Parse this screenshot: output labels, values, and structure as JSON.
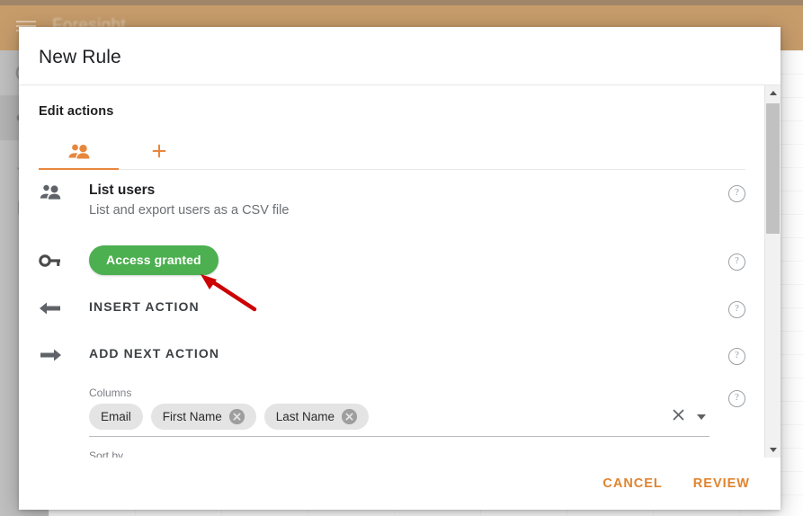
{
  "background": {
    "app_title": "Foresight",
    "menu_icon": "hamburger-icon",
    "appbar_color": "#a9681d",
    "sidebar_icons": [
      "clock-icon",
      "key-icon",
      "chart-icon",
      "building-icon"
    ]
  },
  "dialog": {
    "title": "New Rule",
    "section_heading": "Edit actions",
    "tabs": [
      {
        "icon": "people-icon",
        "name": "tab-users",
        "active": true
      },
      {
        "icon": "plus-icon",
        "name": "tab-add",
        "active": false
      }
    ],
    "accent_color": "#e8873c",
    "rows": {
      "list_users": {
        "icon": "people-icon",
        "title": "List users",
        "subtitle": "List and export users as a CSV file",
        "help": "?"
      },
      "access": {
        "icon": "key-icon",
        "badge_label": "Access granted",
        "badge_color": "#4caf50",
        "help": "?"
      },
      "insert_action": {
        "icon": "arrow-left-icon",
        "label": "INSERT ACTION",
        "help": "?"
      },
      "add_next_action": {
        "icon": "arrow-right-icon",
        "label": "ADD NEXT ACTION",
        "help": "?"
      },
      "columns": {
        "label": "Columns",
        "chips": [
          {
            "label": "Email",
            "removable": false
          },
          {
            "label": "First Name",
            "removable": true
          },
          {
            "label": "Last Name",
            "removable": true
          }
        ],
        "clear_icon": "close-icon",
        "dropdown_icon": "chevron-down-icon",
        "help": "?"
      },
      "sort_by": {
        "label": "Sort by"
      }
    },
    "footer": {
      "cancel_label": "CANCEL",
      "review_label": "REVIEW"
    }
  },
  "annotation": {
    "arrow_color": "#cc0000",
    "points_at": "Access granted"
  }
}
